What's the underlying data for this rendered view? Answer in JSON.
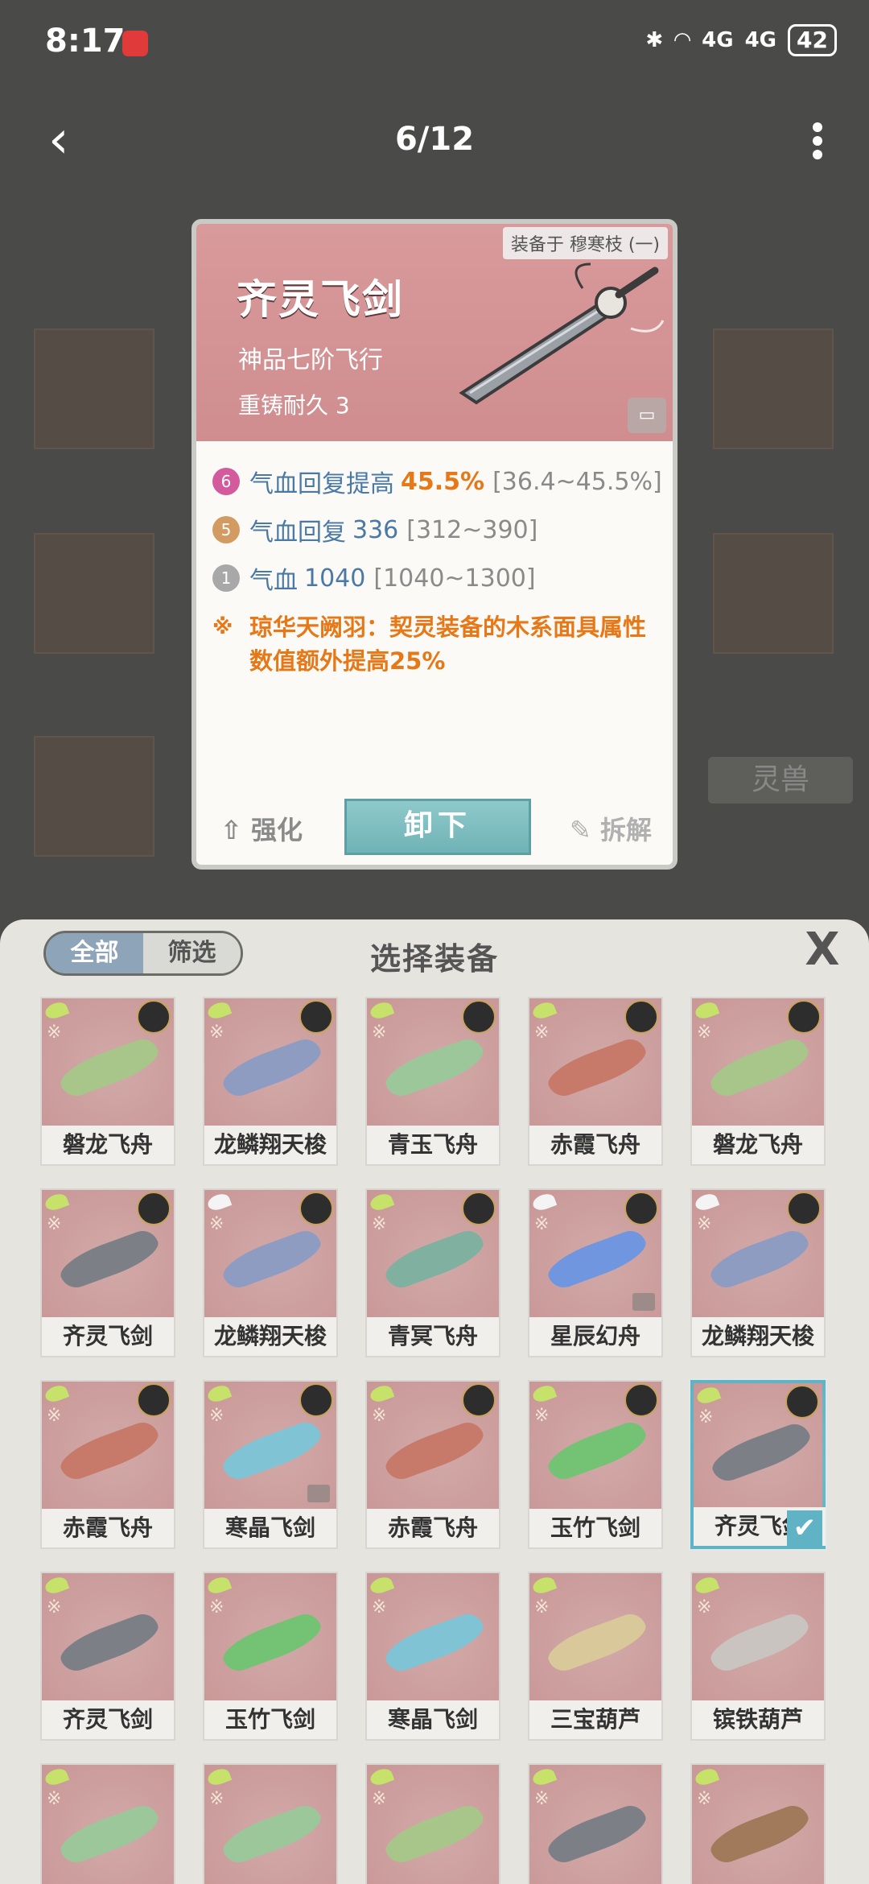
{
  "status": {
    "time": "8:17",
    "bluetooth": "bluetooth-icon",
    "wifi": "wifi-icon",
    "signal1": "4G",
    "signal2": "4G",
    "battery": "42"
  },
  "nav": {
    "page": "6/12"
  },
  "background": {
    "pet_tab": "灵兽"
  },
  "detail": {
    "equipped_by": "装备于 穆寒枝 (一)",
    "name": "齐灵飞剑",
    "grade": "神品七阶飞行",
    "recast": "重铸耐久 3",
    "stats": [
      {
        "badge": "6",
        "label": "气血回复提高",
        "value": "45.5%",
        "range": "[36.4~45.5%]",
        "color": "#d35a9d",
        "highlight": true
      },
      {
        "badge": "5",
        "label": "气血回复",
        "value": "336",
        "range": "[312~390]",
        "color": "#d39a62",
        "highlight": false
      },
      {
        "badge": "1",
        "label": "气血",
        "value": "1040",
        "range": "[1040~1300]",
        "color": "#a8a8a8",
        "highlight": false
      }
    ],
    "special": "琼华天阙羽：契灵装备的木系面具属性数值额外提高25%",
    "enhance": "强化",
    "unequip": "卸下",
    "dismantle": "拆解"
  },
  "panel": {
    "tab_all": "全部",
    "tab_filter": "筛选",
    "title": "选择装备",
    "close": "X",
    "items": [
      {
        "name": "磐龙飞舟",
        "wing": "green",
        "avatar": true,
        "color": "#a8c68a",
        "lock": false,
        "selected": false
      },
      {
        "name": "龙鳞翔天梭",
        "wing": "green",
        "avatar": true,
        "color": "#8f9cc2",
        "lock": false,
        "selected": false
      },
      {
        "name": "青玉飞舟",
        "wing": "green",
        "avatar": true,
        "color": "#9cc79a",
        "lock": false,
        "selected": false
      },
      {
        "name": "赤霞飞舟",
        "wing": "green",
        "avatar": true,
        "color": "#c77a6a",
        "lock": false,
        "selected": false
      },
      {
        "name": "磐龙飞舟",
        "wing": "green",
        "avatar": true,
        "color": "#a8c68a",
        "lock": false,
        "selected": false
      },
      {
        "name": "齐灵飞剑",
        "wing": "green",
        "avatar": true,
        "color": "#7d7f86",
        "lock": false,
        "selected": false
      },
      {
        "name": "龙鳞翔天梭",
        "wing": "plain",
        "avatar": true,
        "color": "#8f9cc2",
        "lock": false,
        "selected": false
      },
      {
        "name": "青冥飞舟",
        "wing": "green",
        "avatar": true,
        "color": "#7fb0a0",
        "lock": false,
        "selected": false
      },
      {
        "name": "星辰幻舟",
        "wing": "plain",
        "avatar": true,
        "color": "#6f96de",
        "lock": true,
        "selected": false
      },
      {
        "name": "龙鳞翔天梭",
        "wing": "plain",
        "avatar": true,
        "color": "#8f9cc2",
        "lock": false,
        "selected": false
      },
      {
        "name": "赤霞飞舟",
        "wing": "green",
        "avatar": true,
        "color": "#c77a6a",
        "lock": false,
        "selected": false
      },
      {
        "name": "寒晶飞剑",
        "wing": "green",
        "avatar": true,
        "color": "#7fc3d4",
        "lock": true,
        "selected": false
      },
      {
        "name": "赤霞飞舟",
        "wing": "green",
        "avatar": true,
        "color": "#c77a6a",
        "lock": false,
        "selected": false
      },
      {
        "name": "玉竹飞剑",
        "wing": "green",
        "avatar": true,
        "color": "#74c274",
        "lock": false,
        "selected": false
      },
      {
        "name": "齐灵飞剑",
        "wing": "green",
        "avatar": true,
        "color": "#7d7f86",
        "lock": false,
        "selected": true
      },
      {
        "name": "齐灵飞剑",
        "wing": "green",
        "avatar": false,
        "color": "#7d7f86",
        "lock": false,
        "selected": false
      },
      {
        "name": "玉竹飞剑",
        "wing": "green",
        "avatar": false,
        "color": "#74c274",
        "lock": false,
        "selected": false
      },
      {
        "name": "寒晶飞剑",
        "wing": "green",
        "avatar": false,
        "color": "#7fc3d4",
        "lock": false,
        "selected": false
      },
      {
        "name": "三宝葫芦",
        "wing": "green",
        "avatar": false,
        "color": "#d8c89a",
        "lock": false,
        "selected": false
      },
      {
        "name": "镔铁葫芦",
        "wing": "green",
        "avatar": false,
        "color": "#c9c4c0",
        "lock": false,
        "selected": false
      },
      {
        "name": "",
        "wing": "green",
        "avatar": false,
        "color": "#9cc79a",
        "lock": false,
        "selected": false
      },
      {
        "name": "",
        "wing": "green",
        "avatar": false,
        "color": "#9cc79a",
        "lock": false,
        "selected": false
      },
      {
        "name": "",
        "wing": "green",
        "avatar": false,
        "color": "#a8c68a",
        "lock": false,
        "selected": false
      },
      {
        "name": "",
        "wing": "green",
        "avatar": false,
        "color": "#7d7f86",
        "lock": false,
        "selected": false
      },
      {
        "name": "",
        "wing": "green",
        "avatar": false,
        "color": "#a07a5a",
        "lock": false,
        "selected": false
      }
    ]
  }
}
